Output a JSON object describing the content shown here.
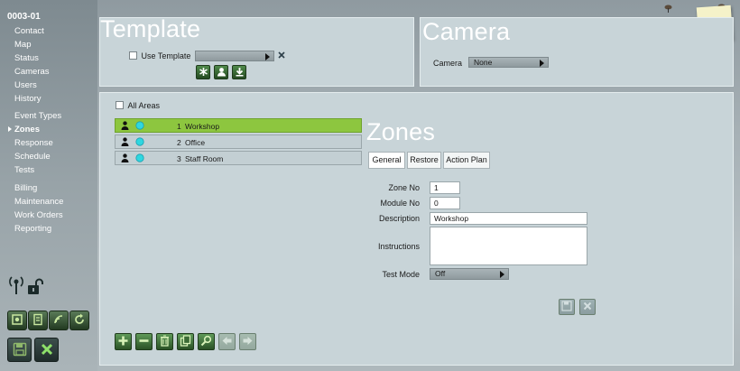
{
  "account": "0003-01",
  "nav": {
    "group1": [
      "Contact",
      "Map",
      "Status",
      "Cameras",
      "Users",
      "History"
    ],
    "group2": [
      "Event Types",
      "Zones",
      "Response",
      "Schedule",
      "Tests"
    ],
    "group3": [
      "Billing",
      "Maintenance",
      "Work Orders",
      "Reporting"
    ],
    "active": "Zones"
  },
  "template": {
    "title": "Template",
    "use_template_label": "Use Template",
    "use_template_checked": false,
    "select_value": ""
  },
  "camera": {
    "title": "Camera",
    "label": "Camera",
    "value": "None"
  },
  "zones_list": {
    "all_areas_label": "All Areas",
    "rows": [
      {
        "no": "1",
        "name": "Workshop",
        "selected": true
      },
      {
        "no": "2",
        "name": "Office",
        "selected": false
      },
      {
        "no": "3",
        "name": "Staff Room",
        "selected": false
      }
    ]
  },
  "zone_detail": {
    "title": "Zones",
    "tabs": [
      "General",
      "Restore",
      "Action Plan"
    ],
    "active_tab": "General",
    "fields": {
      "zone_no_label": "Zone No",
      "zone_no": "1",
      "module_no_label": "Module No",
      "module_no": "0",
      "description_label": "Description",
      "description": "Workshop",
      "instructions_label": "Instructions",
      "instructions": "",
      "test_mode_label": "Test Mode",
      "test_mode": "Off"
    }
  },
  "colors": {
    "selected_row": "#8dc63f",
    "panel_bg": "#c8d4d8",
    "button_green": "#3c6e37"
  }
}
